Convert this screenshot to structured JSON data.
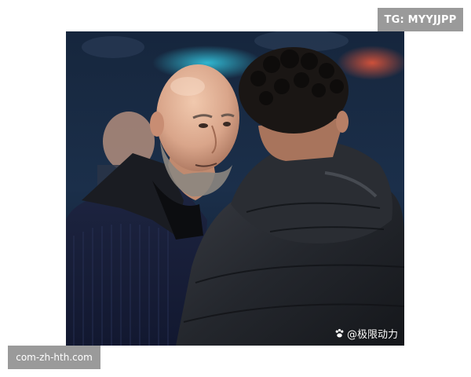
{
  "top_tag": {
    "text": "TG: MYYJJPP"
  },
  "bottom_tag": {
    "text": "com-zh-hth.com"
  },
  "photo": {
    "watermark": {
      "text": "@极限动力",
      "icon": "paw-icon"
    }
  },
  "colors": {
    "tag_background": "#9a9a9a",
    "tag_text": "#ffffff",
    "page_background": "#ffffff"
  }
}
